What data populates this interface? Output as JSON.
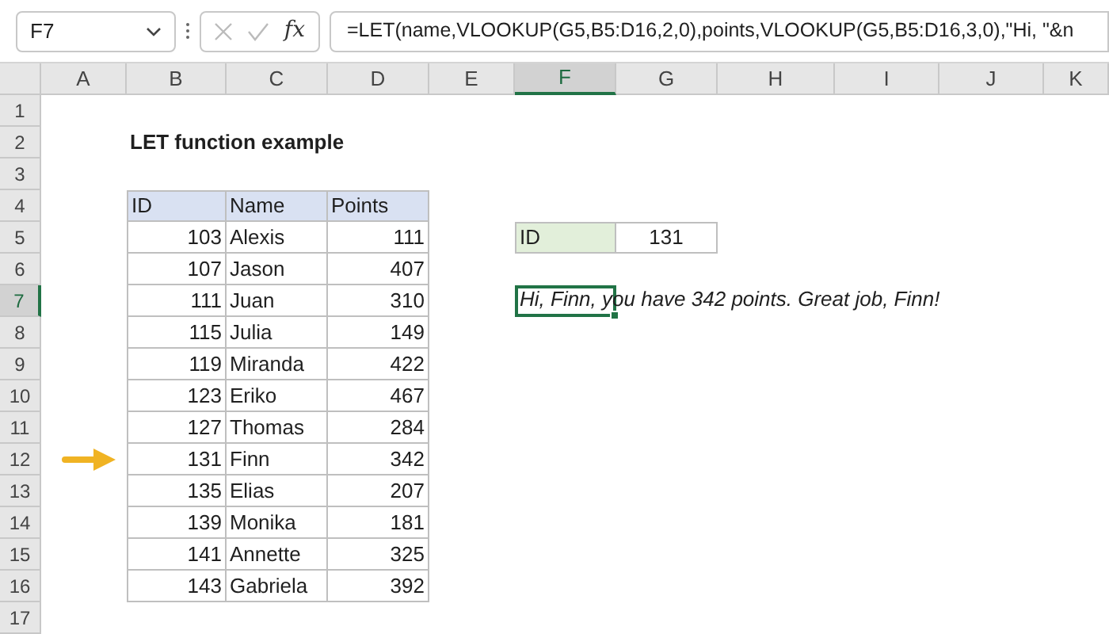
{
  "name_box": "F7",
  "formula_bar": {
    "function_label": "fx",
    "formula": "=LET(name,VLOOKUP(G5,B5:D16,2,0),points,VLOOKUP(G5,B5:D16,3,0),\"Hi, \"&n"
  },
  "columns": [
    {
      "label": "A",
      "selected": false
    },
    {
      "label": "B",
      "selected": false
    },
    {
      "label": "C",
      "selected": false
    },
    {
      "label": "D",
      "selected": false
    },
    {
      "label": "E",
      "selected": false
    },
    {
      "label": "F",
      "selected": true
    },
    {
      "label": "G",
      "selected": false
    },
    {
      "label": "H",
      "selected": false
    },
    {
      "label": "I",
      "selected": false
    },
    {
      "label": "J",
      "selected": false
    },
    {
      "label": "K",
      "selected": false
    }
  ],
  "rows": [
    {
      "label": "1",
      "selected": false
    },
    {
      "label": "2",
      "selected": false
    },
    {
      "label": "3",
      "selected": false
    },
    {
      "label": "4",
      "selected": false
    },
    {
      "label": "5",
      "selected": false
    },
    {
      "label": "6",
      "selected": false
    },
    {
      "label": "7",
      "selected": true
    },
    {
      "label": "8",
      "selected": false
    },
    {
      "label": "9",
      "selected": false
    },
    {
      "label": "10",
      "selected": false
    },
    {
      "label": "11",
      "selected": false
    },
    {
      "label": "12",
      "selected": false
    },
    {
      "label": "13",
      "selected": false
    },
    {
      "label": "14",
      "selected": false
    },
    {
      "label": "15",
      "selected": false
    },
    {
      "label": "16",
      "selected": false
    },
    {
      "label": "17",
      "selected": false
    }
  ],
  "title": "LET function example",
  "table": {
    "columns": [
      "ID",
      "Name",
      "Points"
    ],
    "rows": [
      {
        "id": "103",
        "name": "Alexis",
        "points": "111",
        "pointed": false
      },
      {
        "id": "107",
        "name": "Jason",
        "points": "407",
        "pointed": false
      },
      {
        "id": "111",
        "name": "Juan",
        "points": "310",
        "pointed": false
      },
      {
        "id": "115",
        "name": "Julia",
        "points": "149",
        "pointed": false
      },
      {
        "id": "119",
        "name": "Miranda",
        "points": "422",
        "pointed": false
      },
      {
        "id": "123",
        "name": "Eriko",
        "points": "467",
        "pointed": false
      },
      {
        "id": "127",
        "name": "Thomas",
        "points": "284",
        "pointed": false
      },
      {
        "id": "131",
        "name": "Finn",
        "points": "342",
        "pointed": true
      },
      {
        "id": "135",
        "name": "Elias",
        "points": "207",
        "pointed": false
      },
      {
        "id": "139",
        "name": "Monika",
        "points": "181",
        "pointed": false
      },
      {
        "id": "141",
        "name": "Annette",
        "points": "325",
        "pointed": false
      },
      {
        "id": "143",
        "name": "Gabriela",
        "points": "392",
        "pointed": false
      }
    ]
  },
  "lookup": {
    "label": "ID",
    "value": "131"
  },
  "result": "Hi, Finn, you have 342 points. Great job, Finn!"
}
